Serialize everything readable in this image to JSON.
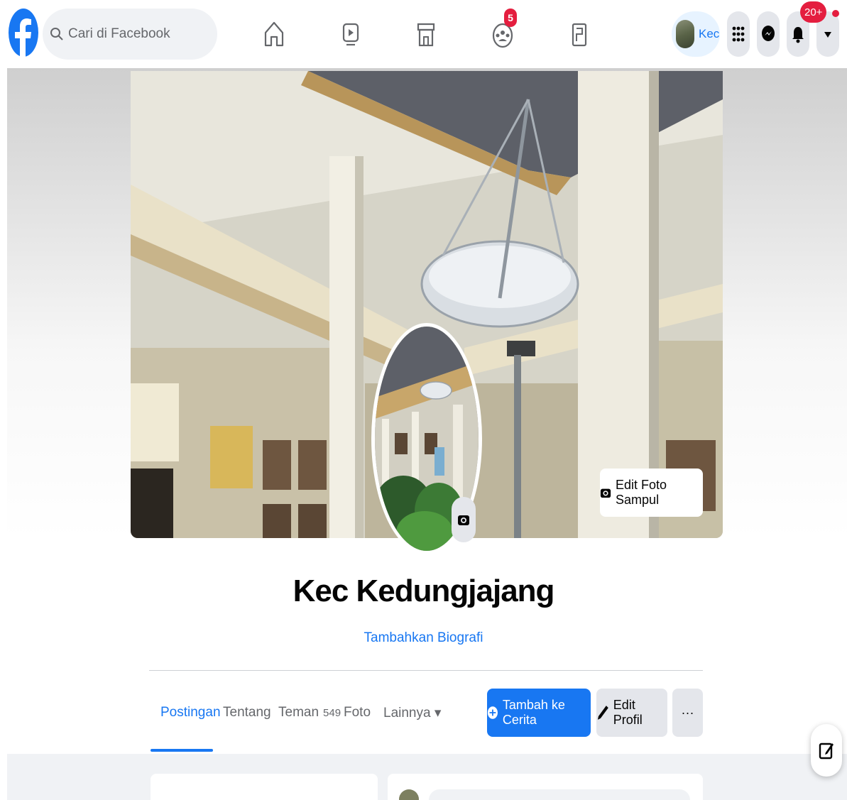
{
  "topbar": {
    "search_placeholder": "Cari di Facebook",
    "nav_icons": [
      "home-icon",
      "watch-icon",
      "marketplace-icon",
      "groups-icon",
      "gaming-icon"
    ],
    "groups_badge": "5",
    "profile_short_name": "Kec",
    "notifications_badge": "20+"
  },
  "profile": {
    "name": "Kec Kedungjajang",
    "add_bio": "Tambahkan Biografi",
    "edit_cover_label": "Edit Foto Sampul"
  },
  "tabs": [
    {
      "label": "Postingan",
      "active": true
    },
    {
      "label": "Tentang"
    },
    {
      "label": "Teman",
      "count": "549"
    },
    {
      "label": "Foto"
    },
    {
      "label": "Lainnya ▾"
    }
  ],
  "actions": {
    "add_story": "Tambah ke Cerita",
    "edit_profile": "Edit Profil",
    "more": "···"
  },
  "colors": {
    "accent": "#1877f2",
    "badge": "#e41e3f",
    "surface": "#f0f2f5"
  }
}
